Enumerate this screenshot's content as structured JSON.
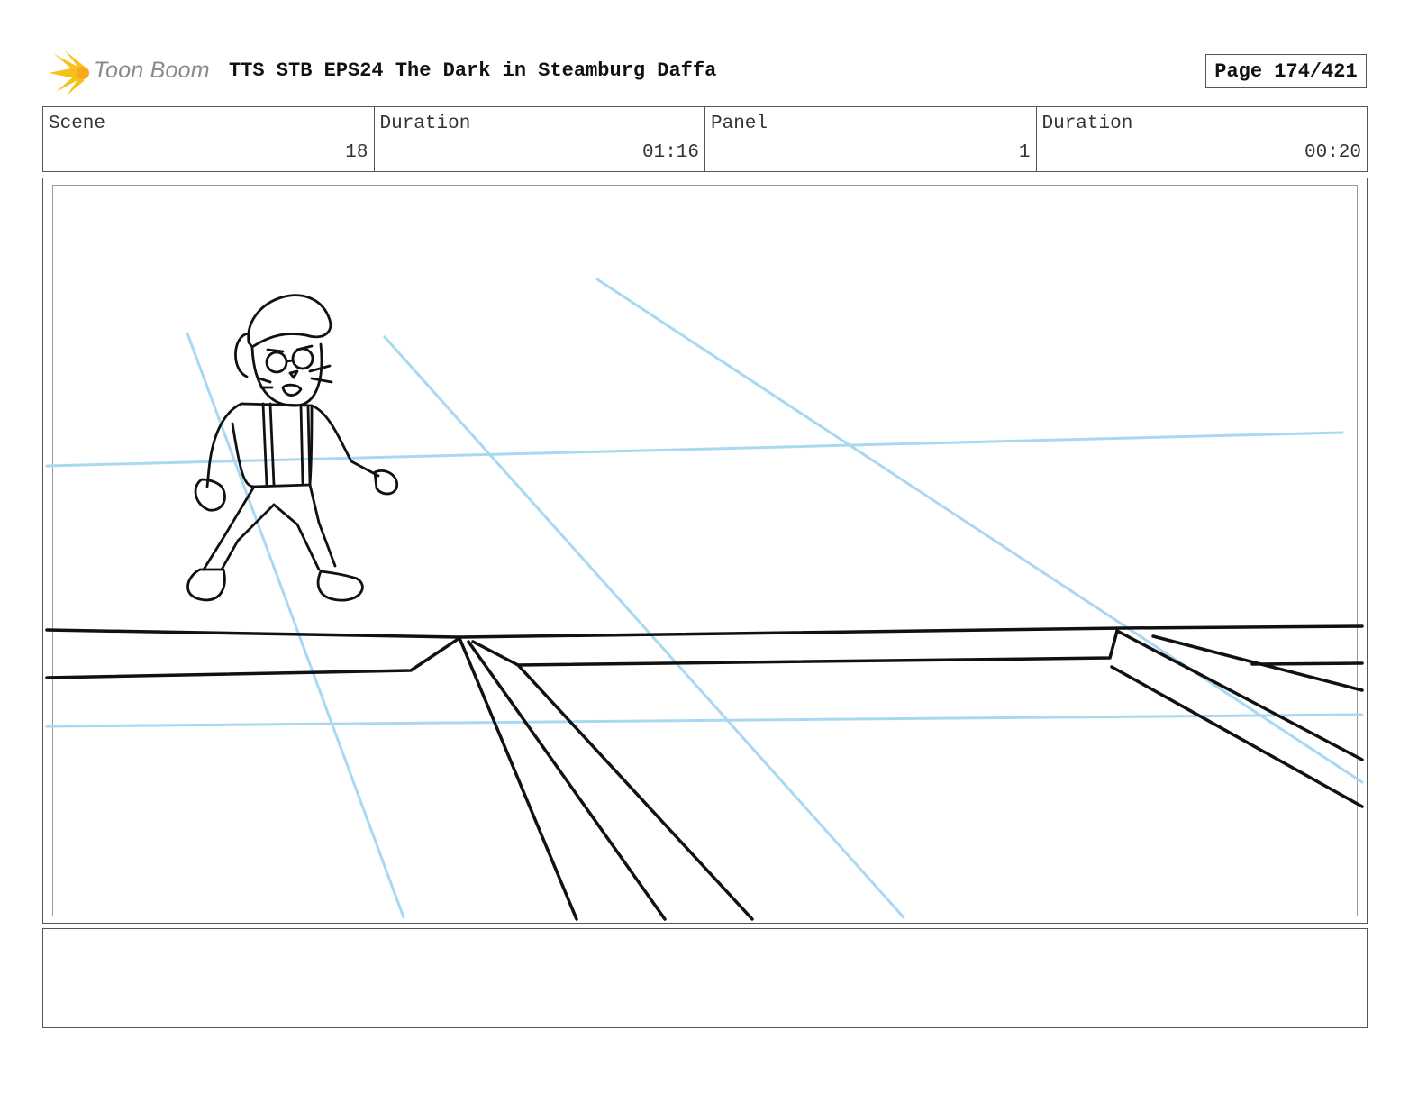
{
  "header": {
    "logo_text": "Toon Boom",
    "title": "TTS STB EPS24 The Dark in Steamburg Daffa",
    "page": "Page 174/421"
  },
  "info": {
    "scene_label": "Scene",
    "scene_value": "18",
    "scene_duration_label": "Duration",
    "scene_duration_value": "01:16",
    "panel_label": "Panel",
    "panel_value": "1",
    "panel_duration_label": "Duration",
    "panel_duration_value": "00:20"
  },
  "panel": {
    "image_icon": "storyboard-sketch",
    "guide_color": "#a9d8f2",
    "line_color": "#111111"
  },
  "notes": {
    "text": ""
  }
}
